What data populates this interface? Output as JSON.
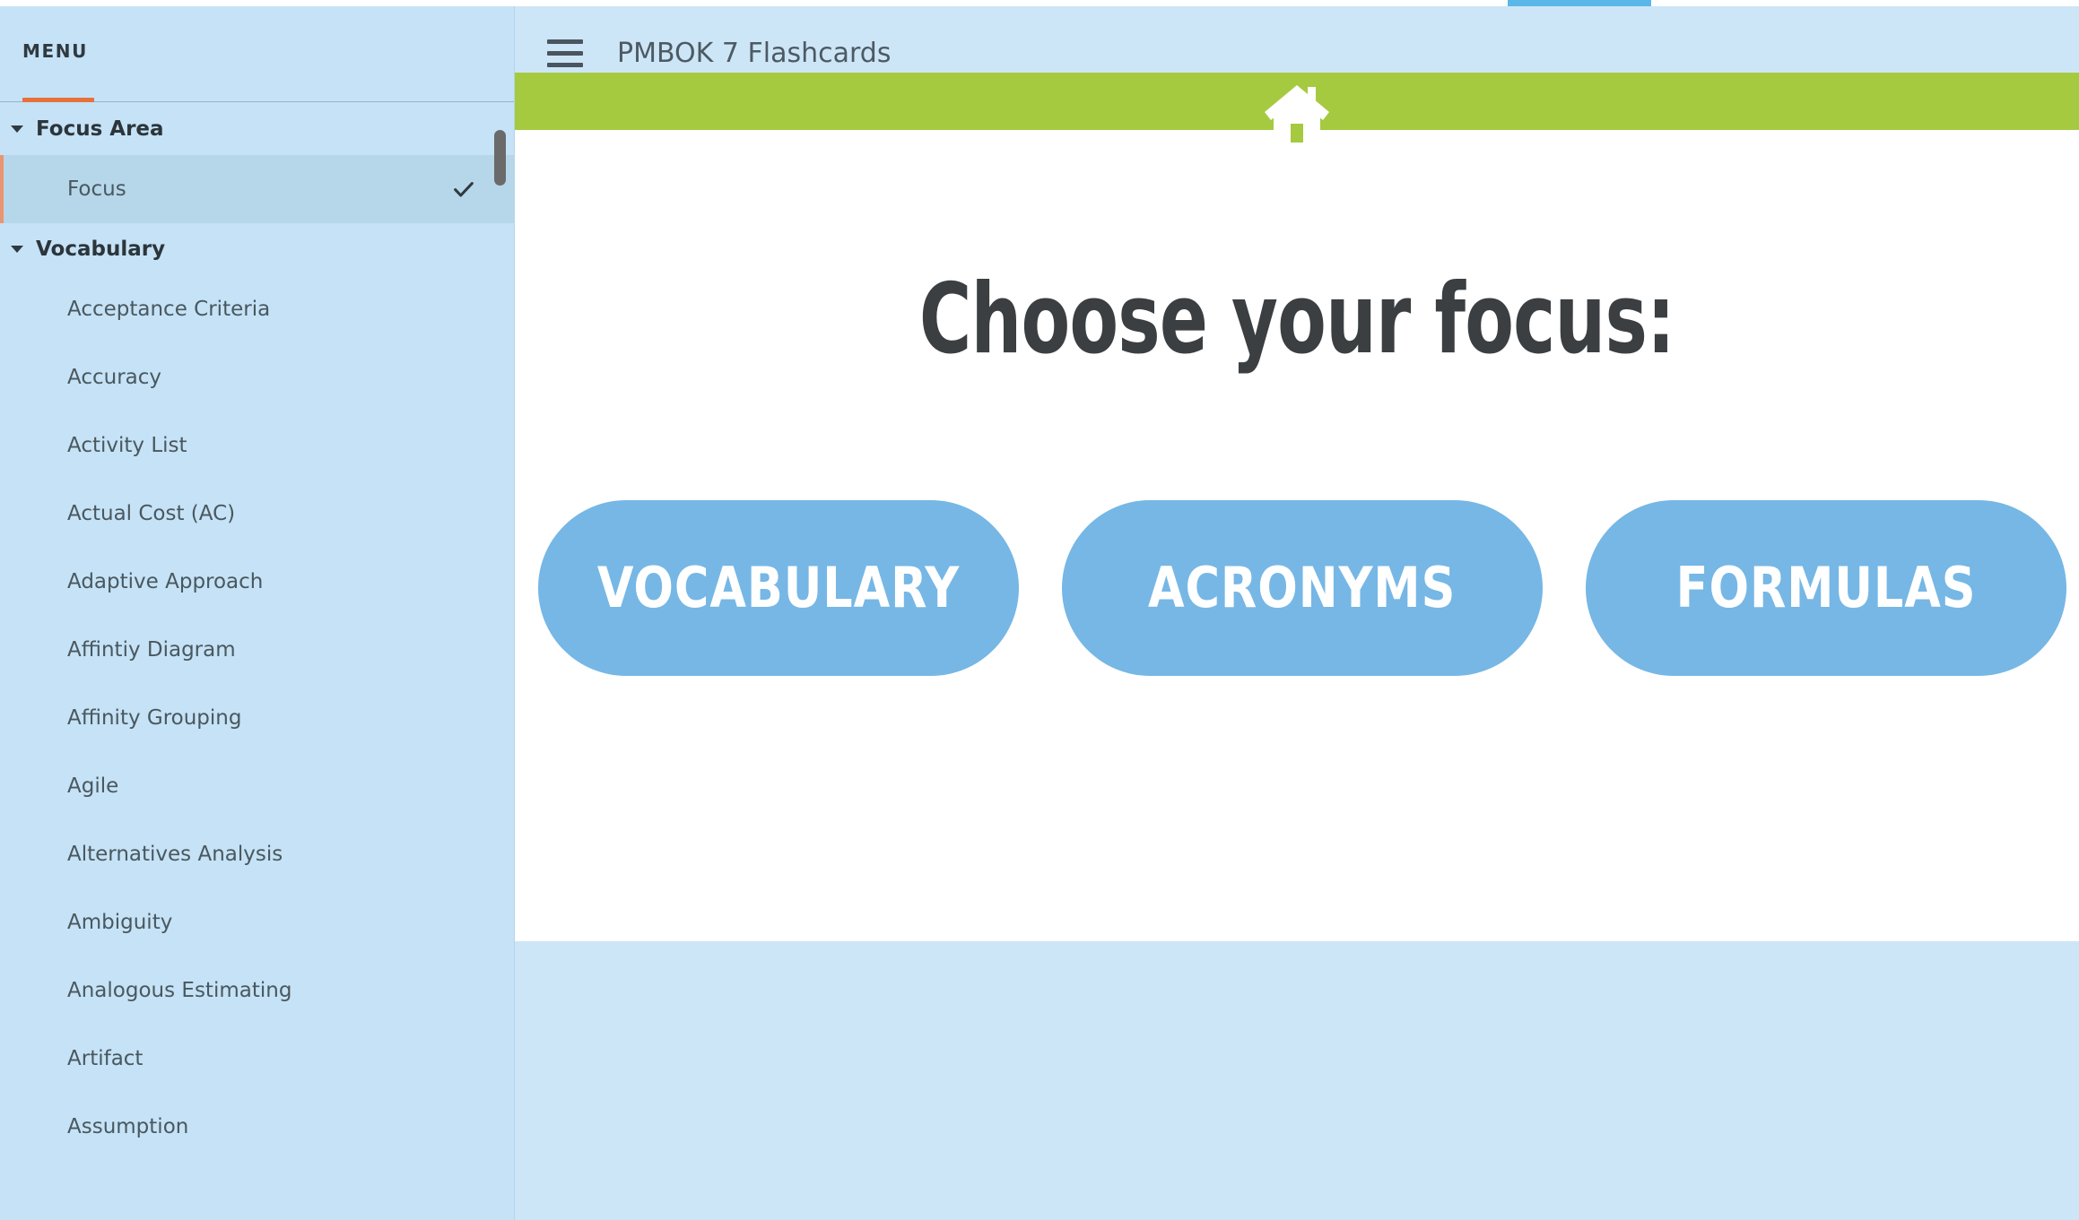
{
  "top_indicator": {
    "accent_color": "#5bb7e8",
    "track_color": "#ffffff"
  },
  "sidebar": {
    "header_label": "MENU",
    "accent_color": "#e8703a",
    "background_color": "#c6e2f6",
    "groups": [
      {
        "title": "Focus Area",
        "expanded": true,
        "items": [
          {
            "label": "Focus",
            "selected": true,
            "check": true
          }
        ]
      },
      {
        "title": "Vocabulary",
        "expanded": true,
        "items": [
          {
            "label": "Acceptance Criteria",
            "selected": false,
            "check": false
          },
          {
            "label": "Accuracy",
            "selected": false,
            "check": false
          },
          {
            "label": "Activity List",
            "selected": false,
            "check": false
          },
          {
            "label": "Actual Cost (AC)",
            "selected": false,
            "check": false
          },
          {
            "label": "Adaptive Approach",
            "selected": false,
            "check": false
          },
          {
            "label": "Affintiy Diagram",
            "selected": false,
            "check": false
          },
          {
            "label": "Affinity Grouping",
            "selected": false,
            "check": false
          },
          {
            "label": "Agile",
            "selected": false,
            "check": false
          },
          {
            "label": "Alternatives Analysis",
            "selected": false,
            "check": false
          },
          {
            "label": "Ambiguity",
            "selected": false,
            "check": false
          },
          {
            "label": "Analogous Estimating",
            "selected": false,
            "check": false
          },
          {
            "label": "Artifact",
            "selected": false,
            "check": false
          },
          {
            "label": "Assumption",
            "selected": false,
            "check": false
          }
        ]
      }
    ],
    "scrollbar": {
      "name": "sidebar-scrollbar"
    }
  },
  "topbar": {
    "menu_icon": "hamburger-icon",
    "title": "PMBOK 7 Flashcards"
  },
  "card": {
    "greenbar_color": "#a5ca3f",
    "home_icon": "home-icon",
    "heading": "Choose your focus:",
    "choices": [
      {
        "label": "VOCABULARY"
      },
      {
        "label": "ACRONYMS"
      },
      {
        "label": "FORMULAS"
      }
    ],
    "choice_color": "#76b7e5"
  }
}
